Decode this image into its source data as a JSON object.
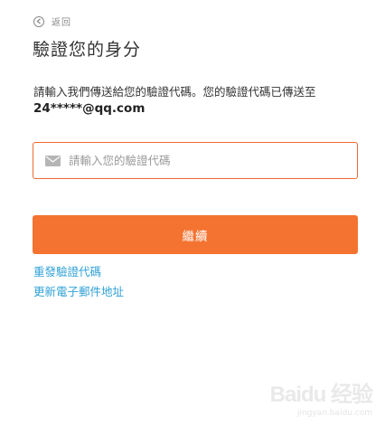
{
  "back": {
    "label": "返回",
    "icon": "chevron-left-circle-icon"
  },
  "page": {
    "title": "驗證您的身分"
  },
  "instruction": {
    "text": "請輸入我們傳送給您的驗證代碼。您的驗證代碼已傳送至",
    "email": "24*****@qq.com"
  },
  "code_input": {
    "placeholder": "請輸入您的驗證代碼",
    "value": "",
    "icon": "mail-icon",
    "border_color": "#f06a30"
  },
  "continue_button": {
    "label": "繼續",
    "color": "#f47330"
  },
  "links": {
    "resend": "重發驗證代碼",
    "update_email": "更新電子郵件地址",
    "color": "#2fa1d6"
  },
  "watermark": {
    "brand": "Baidu 经验",
    "sub": "jingyan.baidu.com"
  }
}
